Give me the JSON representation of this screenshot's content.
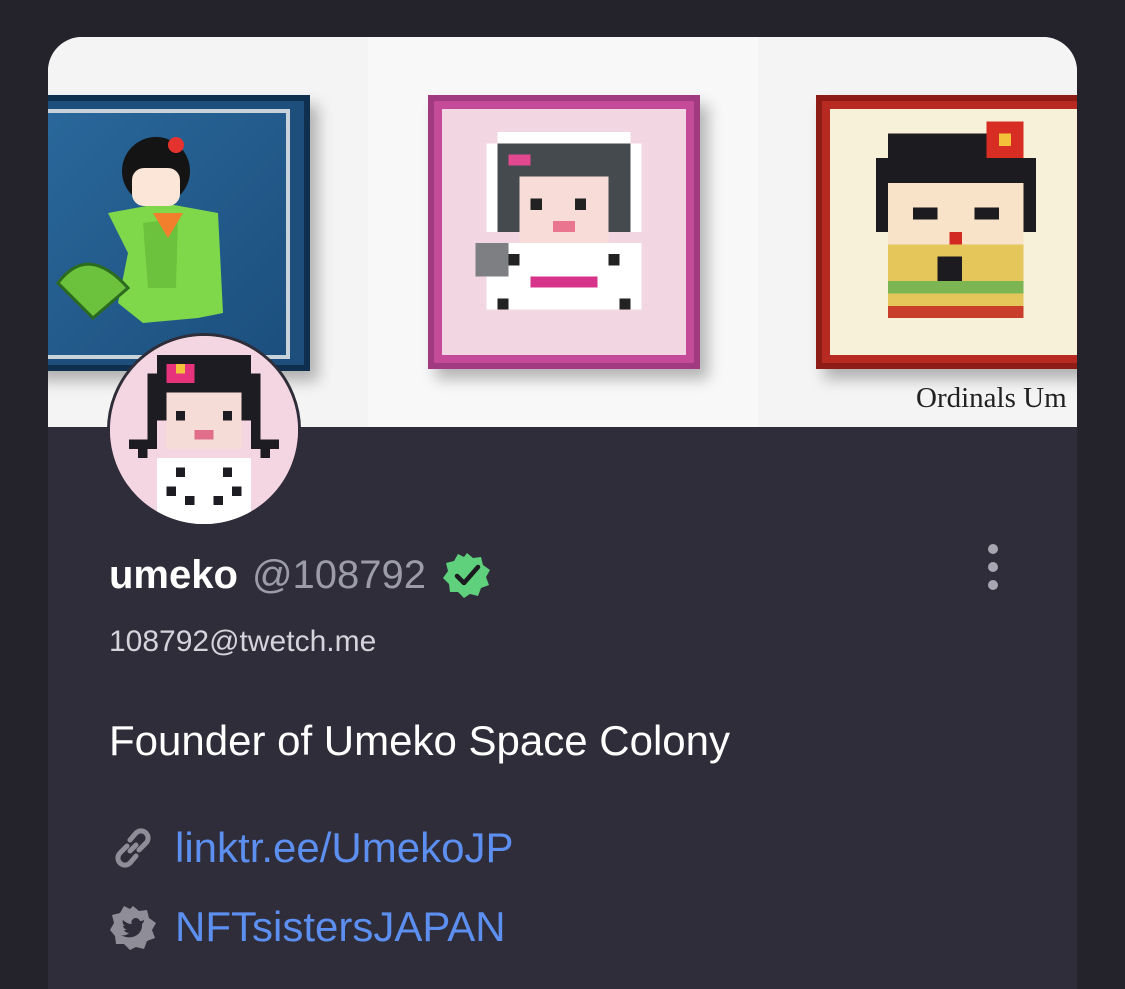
{
  "colors": {
    "page_background": "#24232c",
    "card_background": "#2e2d39",
    "link": "#5c8ff0",
    "verified_badge": "#5fd07c",
    "handle": "#9c9ba8"
  },
  "banner": {
    "caption": "Ordinals Um"
  },
  "profile": {
    "display_name": "umeko",
    "handle": "@108792",
    "verified": true,
    "email": "108792@twetch.me",
    "bio": "Founder of Umeko Space Colony"
  },
  "links": [
    {
      "icon": "link-icon",
      "text": "linktr.ee/UmekoJP"
    },
    {
      "icon": "twitter-icon",
      "text": "NFTsistersJAPAN"
    }
  ],
  "icons": {
    "verified": "verified-check-icon",
    "more": "more-vertical-icon"
  }
}
